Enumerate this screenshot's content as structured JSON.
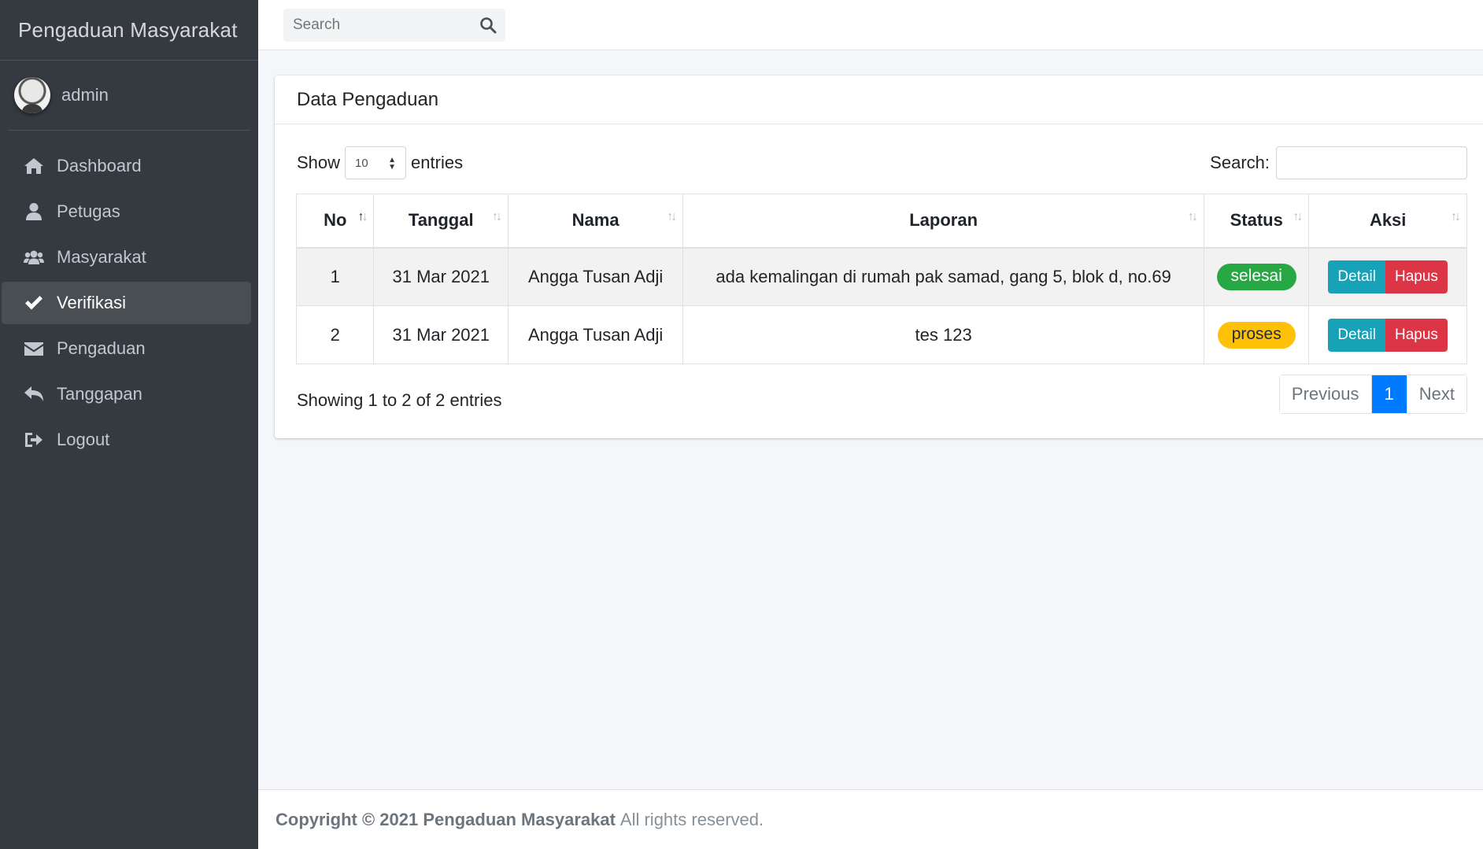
{
  "brand": {
    "title": "Pengaduan Masyarakat"
  },
  "user": {
    "name": "admin"
  },
  "sidebar": {
    "items": [
      {
        "label": "Dashboard",
        "icon": "home-icon"
      },
      {
        "label": "Petugas",
        "icon": "user-icon"
      },
      {
        "label": "Masyarakat",
        "icon": "users-icon"
      },
      {
        "label": "Verifikasi",
        "icon": "check-icon",
        "active": true
      },
      {
        "label": "Pengaduan",
        "icon": "envelope-icon"
      },
      {
        "label": "Tanggapan",
        "icon": "reply-icon"
      },
      {
        "label": "Logout",
        "icon": "sign-out-icon"
      }
    ]
  },
  "topbar": {
    "search_placeholder": "Search"
  },
  "card": {
    "title": "Data Pengaduan",
    "show_label": "Show",
    "entries_label": "entries",
    "page_length": "10",
    "search_label": "Search:"
  },
  "table": {
    "headers": [
      "No",
      "Tanggal",
      "Nama",
      "Laporan",
      "Status",
      "Aksi"
    ],
    "rows": [
      {
        "no": "1",
        "tanggal": "31 Mar 2021",
        "nama": "Angga Tusan Adji",
        "laporan": "ada kemalingan di rumah pak samad, gang 5, blok d, no.69",
        "status": "selesai"
      },
      {
        "no": "2",
        "tanggal": "31 Mar 2021",
        "nama": "Angga Tusan Adji",
        "laporan": "tes 123",
        "status": "proses"
      }
    ],
    "detail_label": "Detail",
    "hapus_label": "Hapus"
  },
  "footer_info": "Showing 1 to 2 of 2 entries",
  "pagination": {
    "previous": "Previous",
    "current": "1",
    "next": "Next"
  },
  "footer": {
    "copyright": "Copyright © 2021 Pengaduan Masyarakat",
    "rights": "All rights reserved."
  },
  "colors": {
    "sidebar": "#343a40",
    "primary": "#007bff",
    "success": "#28a745",
    "warning": "#ffc107",
    "info": "#17a2b8",
    "danger": "#dc3545"
  }
}
